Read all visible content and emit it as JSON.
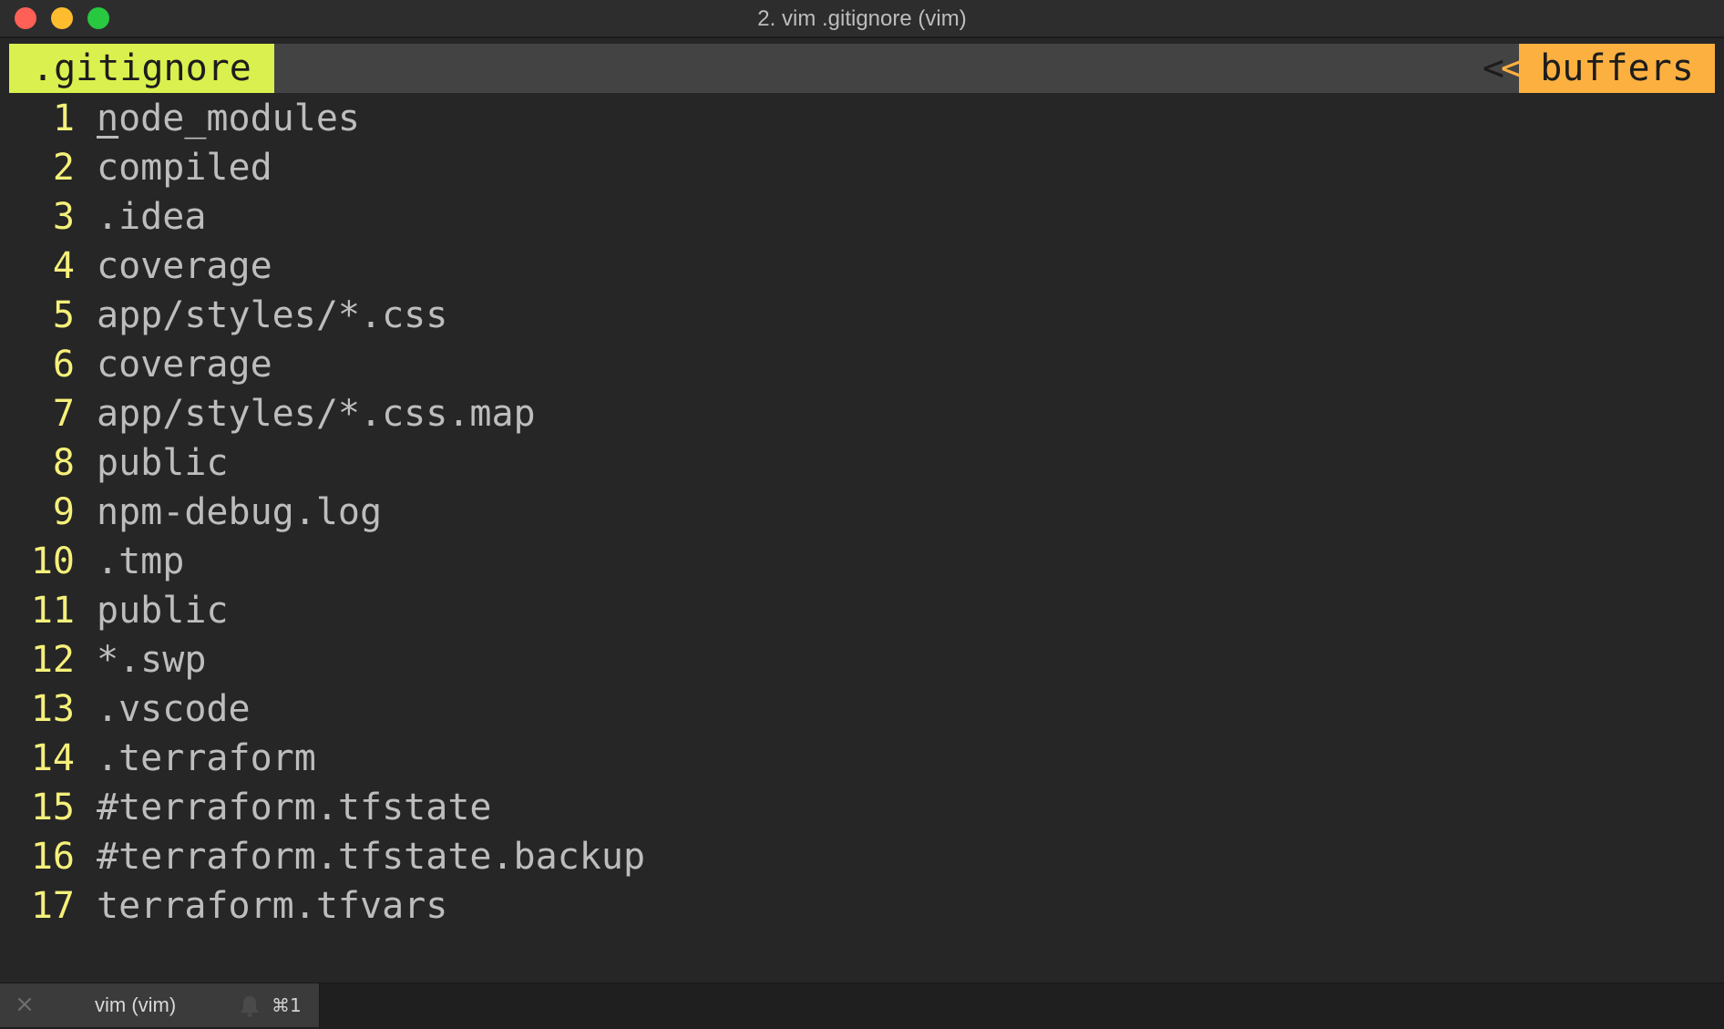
{
  "window": {
    "title": "2. vim .gitignore (vim)"
  },
  "tabline": {
    "active_file": ".gitignore",
    "buffers_separator": "<<",
    "buffers_label": "buffers"
  },
  "editor": {
    "lines": [
      {
        "num": "1",
        "text": "node_modules"
      },
      {
        "num": "2",
        "text": "compiled"
      },
      {
        "num": "3",
        "text": ".idea"
      },
      {
        "num": "4",
        "text": "coverage"
      },
      {
        "num": "5",
        "text": "app/styles/*.css"
      },
      {
        "num": "6",
        "text": "coverage"
      },
      {
        "num": "7",
        "text": "app/styles/*.css.map"
      },
      {
        "num": "8",
        "text": "public"
      },
      {
        "num": "9",
        "text": "npm-debug.log"
      },
      {
        "num": "10",
        "text": ".tmp"
      },
      {
        "num": "11",
        "text": "public"
      },
      {
        "num": "12",
        "text": "*.swp"
      },
      {
        "num": "13",
        "text": ".vscode"
      },
      {
        "num": "14",
        "text": ".terraform"
      },
      {
        "num": "15",
        "text": "#terraform.tfstate"
      },
      {
        "num": "16",
        "text": "#terraform.tfstate.backup"
      },
      {
        "num": "17",
        "text": "terraform.tfvars"
      }
    ]
  },
  "terminal_tab": {
    "label": "vim (vim)",
    "shortcut": "⌘1",
    "close_icon": "×",
    "bell_icon": "bell-icon"
  },
  "colors": {
    "background": "#262626",
    "line_number": "#f5f07a",
    "text": "#bdbdbd",
    "tab_active_bg": "#daf04e",
    "buffers_bg": "#fcb040",
    "traffic_close": "#fe5f57",
    "traffic_minimize": "#febc2e",
    "traffic_zoom": "#28c840"
  }
}
